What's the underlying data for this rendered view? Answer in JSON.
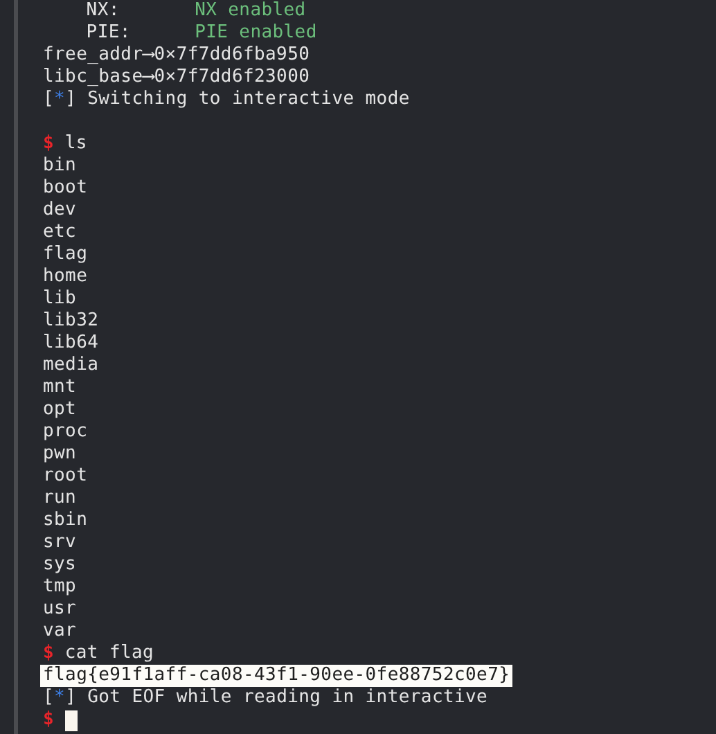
{
  "lines": [
    {
      "kind": "checksec",
      "label": "NX:",
      "value": "NX enabled"
    },
    {
      "kind": "checksec",
      "label": "PIE:",
      "value": "PIE enabled"
    },
    {
      "kind": "output",
      "text": "free_addr⟶0×7f7dd6fba950"
    },
    {
      "kind": "output",
      "text": "libc_base⟶0×7f7dd6f23000"
    },
    {
      "kind": "status",
      "open": "[",
      "marker": "*",
      "close": "]",
      "text": "Switching to interactive mode"
    },
    {
      "kind": "blank"
    },
    {
      "kind": "prompt",
      "symbol": "$",
      "command": "ls"
    },
    {
      "kind": "output",
      "text": "bin"
    },
    {
      "kind": "output",
      "text": "boot"
    },
    {
      "kind": "output",
      "text": "dev"
    },
    {
      "kind": "output",
      "text": "etc"
    },
    {
      "kind": "output",
      "text": "flag"
    },
    {
      "kind": "output",
      "text": "home"
    },
    {
      "kind": "output",
      "text": "lib"
    },
    {
      "kind": "output",
      "text": "lib32"
    },
    {
      "kind": "output",
      "text": "lib64"
    },
    {
      "kind": "output",
      "text": "media"
    },
    {
      "kind": "output",
      "text": "mnt"
    },
    {
      "kind": "output",
      "text": "opt"
    },
    {
      "kind": "output",
      "text": "proc"
    },
    {
      "kind": "output",
      "text": "pwn"
    },
    {
      "kind": "output",
      "text": "root"
    },
    {
      "kind": "output",
      "text": "run"
    },
    {
      "kind": "output",
      "text": "sbin"
    },
    {
      "kind": "output",
      "text": "srv"
    },
    {
      "kind": "output",
      "text": "sys"
    },
    {
      "kind": "output",
      "text": "tmp"
    },
    {
      "kind": "output",
      "text": "usr"
    },
    {
      "kind": "output",
      "text": "var"
    },
    {
      "kind": "prompt",
      "symbol": "$",
      "command": "cat flag"
    },
    {
      "kind": "output",
      "text": "flag{e91f1aff-ca08-43f1-90ee-0fe88752c0e7}",
      "selected": true
    },
    {
      "kind": "status",
      "open": "[",
      "marker": "*",
      "close": "]",
      "text": "Got EOF while reading in interactive"
    },
    {
      "kind": "prompt",
      "symbol": "$",
      "cursor": true
    }
  ]
}
